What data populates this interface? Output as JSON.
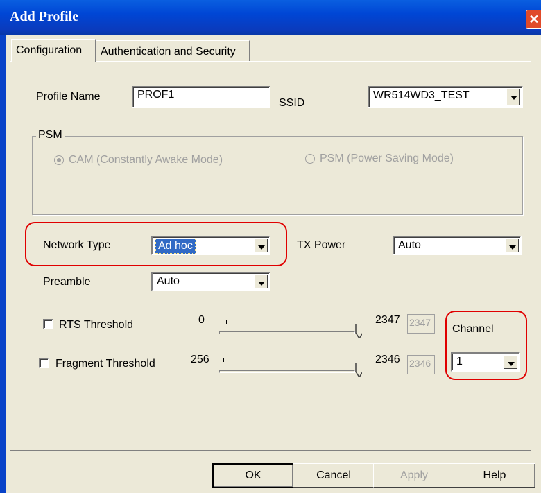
{
  "window": {
    "title": "Add Profile",
    "close_glyph": "✕"
  },
  "tabs": [
    {
      "label": "Configuration",
      "active": true
    },
    {
      "label": "Authentication and Security",
      "active": false
    }
  ],
  "profile": {
    "name_label": "Profile Name",
    "name_value": "PROF1",
    "ssid_label": "SSID",
    "ssid_value": "WR514WD3_TEST"
  },
  "psm": {
    "group_label": "PSM",
    "options": [
      {
        "label": "CAM (Constantly Awake Mode)",
        "checked": true,
        "enabled": false
      },
      {
        "label": "PSM (Power Saving Mode)",
        "checked": false,
        "enabled": false
      }
    ]
  },
  "network_type": {
    "label": "Network Type",
    "value": "Ad hoc"
  },
  "tx_power": {
    "label": "TX Power",
    "value": "Auto"
  },
  "preamble": {
    "label": "Preamble",
    "value": "Auto"
  },
  "rts": {
    "label": "RTS Threshold",
    "checked": false,
    "min": "0",
    "max": "2347",
    "value": "2347"
  },
  "fragment": {
    "label": "Fragment Threshold",
    "checked": false,
    "min": "256",
    "max": "2346",
    "value": "2346"
  },
  "channel": {
    "label": "Channel",
    "value": "1"
  },
  "buttons": {
    "ok": "OK",
    "cancel": "Cancel",
    "apply": "Apply",
    "help": "Help"
  },
  "colors": {
    "title_bar": "#0046d5",
    "highlight_outline": "#e00000",
    "selection": "#316ac5"
  }
}
